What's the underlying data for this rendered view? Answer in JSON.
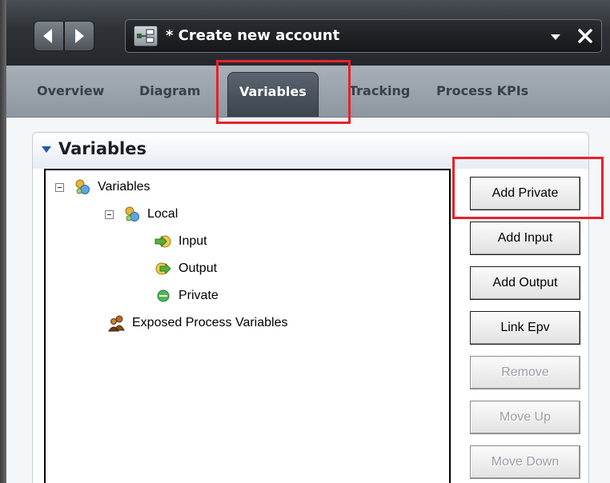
{
  "document": {
    "title": "* Create new account"
  },
  "tabs": [
    {
      "label": "Overview",
      "active": false
    },
    {
      "label": "Diagram",
      "active": false
    },
    {
      "label": "Variables",
      "active": true
    },
    {
      "label": "Tracking",
      "active": false
    },
    {
      "label": "Process KPIs",
      "active": false
    }
  ],
  "section": {
    "title": "Variables"
  },
  "tree": {
    "root": "Variables",
    "local": "Local",
    "input": "Input",
    "output": "Output",
    "private": "Private",
    "exposed": "Exposed Process Variables"
  },
  "buttons": {
    "add_private": "Add Private",
    "add_input": "Add Input",
    "add_output": "Add Output",
    "link_epv": "Link Epv",
    "remove": "Remove",
    "move_up": "Move Up",
    "move_down": "Move Down"
  },
  "colors": {
    "highlight": "#e8212b",
    "active_tab": "#4a535d"
  },
  "icons": {
    "back": "back-arrow-icon",
    "forward": "forward-arrow-icon",
    "process": "process-diagram-icon",
    "dropdown": "triangle-down-icon",
    "close": "close-icon"
  }
}
